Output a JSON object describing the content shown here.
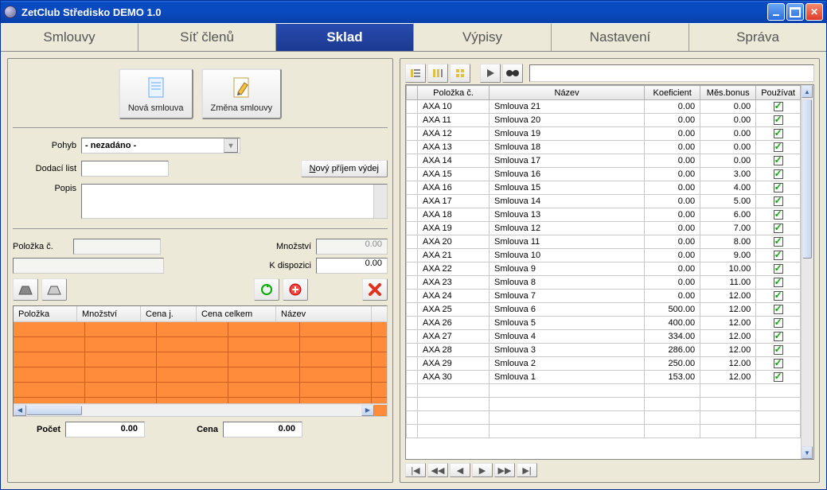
{
  "title": "ZetClub Středisko DEMO 1.0",
  "tabs": [
    "Smlouvy",
    "Síť členů",
    "Sklad",
    "Výpisy",
    "Nastavení",
    "Správa"
  ],
  "activeTab": 2,
  "left": {
    "btnNew": "Nová smlouva",
    "btnEdit": "Změna smlouvy",
    "labels": {
      "pohyb": "Pohyb",
      "dodaci": "Dodací list",
      "popis": "Popis",
      "polozka": "Položka č.",
      "mnozstvi": "Množství",
      "kdispozici": "K dispozici"
    },
    "pohybValue": "- nezadáno -",
    "btnNovyPrijem": "Nový příjem výdej",
    "mnozstviValue": "0.00",
    "kdispoziciValue": "0.00",
    "miniCols": [
      "Položka",
      "Množství",
      "Cena j.",
      "Cena celkem",
      "Název"
    ],
    "footer": {
      "pocetLabel": "Počet",
      "pocetVal": "0.00",
      "cenaLabel": "Cena",
      "cenaVal": "0.00"
    }
  },
  "right": {
    "cols": [
      "Položka č.",
      "Název",
      "Koeficient",
      "Měs.bonus",
      "Používat"
    ],
    "rows": [
      {
        "id": "AXA 10",
        "name": "Smlouva 21",
        "k": "0.00",
        "m": "0.00",
        "use": true
      },
      {
        "id": "AXA 11",
        "name": "Smlouva 20",
        "k": "0.00",
        "m": "0.00",
        "use": true
      },
      {
        "id": "AXA 12",
        "name": "Smlouva 19",
        "k": "0.00",
        "m": "0.00",
        "use": true
      },
      {
        "id": "AXA 13",
        "name": "Smlouva 18",
        "k": "0.00",
        "m": "0.00",
        "use": true
      },
      {
        "id": "AXA 14",
        "name": "Smlouva 17",
        "k": "0.00",
        "m": "0.00",
        "use": true
      },
      {
        "id": "AXA 15",
        "name": "Smlouva 16",
        "k": "0.00",
        "m": "3.00",
        "use": true
      },
      {
        "id": "AXA 16",
        "name": "Smlouva 15",
        "k": "0.00",
        "m": "4.00",
        "use": true
      },
      {
        "id": "AXA 17",
        "name": "Smlouva 14",
        "k": "0.00",
        "m": "5.00",
        "use": true
      },
      {
        "id": "AXA 18",
        "name": "Smlouva 13",
        "k": "0.00",
        "m": "6.00",
        "use": true
      },
      {
        "id": "AXA 19",
        "name": "Smlouva 12",
        "k": "0.00",
        "m": "7.00",
        "use": true
      },
      {
        "id": "AXA 20",
        "name": "Smlouva 11",
        "k": "0.00",
        "m": "8.00",
        "use": true
      },
      {
        "id": "AXA 21",
        "name": "Smlouva 10",
        "k": "0.00",
        "m": "9.00",
        "use": true
      },
      {
        "id": "AXA 22",
        "name": "Smlouva 9",
        "k": "0.00",
        "m": "10.00",
        "use": true
      },
      {
        "id": "AXA 23",
        "name": "Smlouva 8",
        "k": "0.00",
        "m": "11.00",
        "use": true
      },
      {
        "id": "AXA 24",
        "name": "Smlouva 7",
        "k": "0.00",
        "m": "12.00",
        "use": true
      },
      {
        "id": "AXA 25",
        "name": "Smlouva 6",
        "k": "500.00",
        "m": "12.00",
        "use": true
      },
      {
        "id": "AXA 26",
        "name": "Smlouva 5",
        "k": "400.00",
        "m": "12.00",
        "use": true
      },
      {
        "id": "AXA 27",
        "name": "Smlouva 4",
        "k": "334.00",
        "m": "12.00",
        "use": true
      },
      {
        "id": "AXA 28",
        "name": "Smlouva 3",
        "k": "286.00",
        "m": "12.00",
        "use": true
      },
      {
        "id": "AXA 29",
        "name": "Smlouva 2",
        "k": "250.00",
        "m": "12.00",
        "use": true
      },
      {
        "id": "AXA 30",
        "name": "Smlouva 1",
        "k": "153.00",
        "m": "12.00",
        "use": true
      }
    ]
  }
}
